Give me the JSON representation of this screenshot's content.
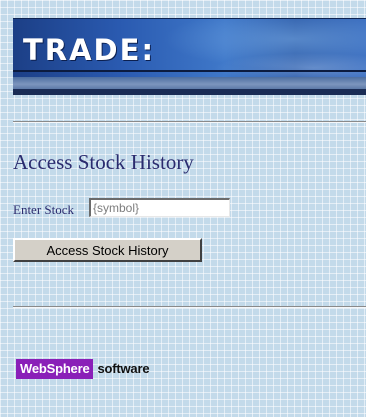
{
  "banner": {
    "title": "TRADE:"
  },
  "main": {
    "heading": "Access Stock History",
    "input_label": "Enter Stock",
    "symbol_value": "{symbol}",
    "submit_label": "Access Stock History"
  },
  "footer": {
    "logo_brand": "WebSphere",
    "logo_suffix": "software"
  },
  "colors": {
    "page_background": "#c3daea",
    "heading_text": "#2a2b6e",
    "banner_blue": "#2a5ab0",
    "logo_purple": "#8a1fb8"
  }
}
